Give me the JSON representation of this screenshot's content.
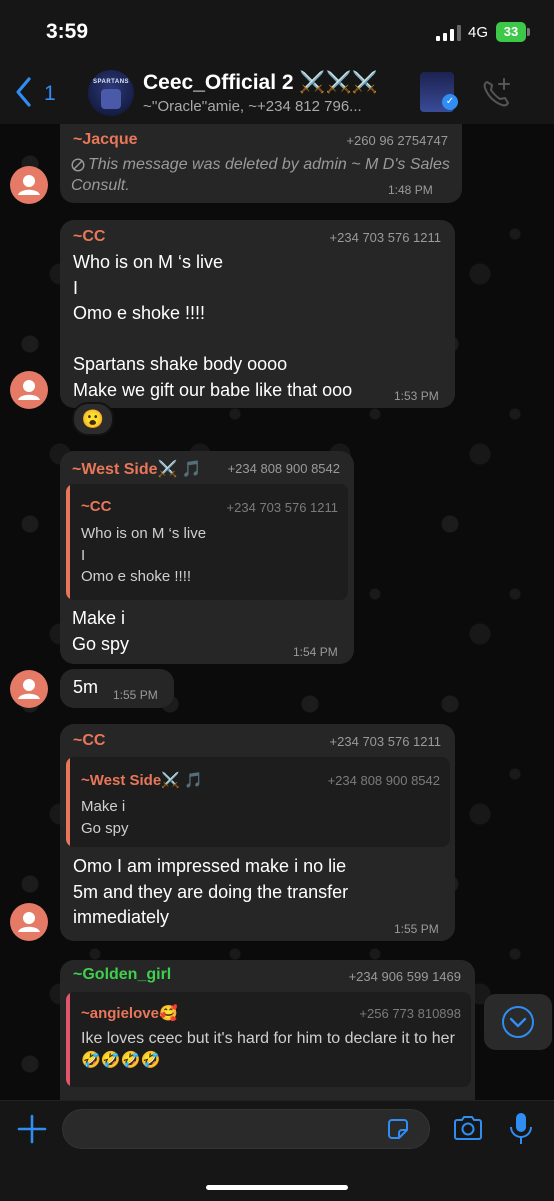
{
  "status_bar": {
    "time": "3:59",
    "network": "4G",
    "battery": "33"
  },
  "header": {
    "back_count": "1",
    "group_avatar_text": "SPARTANS",
    "title": "Ceec_Official 2 ⚔️⚔️⚔️",
    "subtitle": "~''Oracle''amie, ~+234 812 796..."
  },
  "messages": [
    {
      "sender": "~Jacque",
      "sender_color": "#e8775a",
      "phone": "+260 96 2754747",
      "deleted_text": "This message was deleted by admin ~ M D's Sales Consult.",
      "time": "1:48 PM"
    },
    {
      "sender": "~CC",
      "sender_color": "#e8775a",
      "phone": "+234 703 576 1211",
      "body": "Who is on M ‘s live\nI\nOmo e shoke !!!!\n\nSpartans shake body oooo\nMake we gift our babe like that ooo",
      "time": "1:53 PM",
      "reaction": "😮"
    },
    {
      "sender": "~West Side⚔️ 🎵",
      "sender_color": "#e8775a",
      "phone": "+234 808 900 8542",
      "quote": {
        "sender": "~CC",
        "phone": "+234 703 576 1211",
        "body": "Who is on M ‘s live\nI\nOmo e shoke !!!!"
      },
      "body": "Make i\nGo spy",
      "time": "1:54 PM"
    },
    {
      "body": "5m",
      "time": "1:55 PM"
    },
    {
      "sender": "~CC",
      "sender_color": "#e8775a",
      "phone": "+234 703 576 1211",
      "quote": {
        "sender": "~West Side⚔️ 🎵",
        "phone": "+234 808 900 8542",
        "body": "Make i\nGo spy"
      },
      "body": "Omo I am impressed make i no lie\n5m and they are doing the transfer\nimmediately",
      "time": "1:55 PM"
    },
    {
      "sender": "~Golden_girl",
      "sender_color": "#3ecf4e",
      "phone": "+234 906 599 1469",
      "quote": {
        "sender": "~angielove🥰",
        "phone": "+256 773 810898",
        "body": "Ike loves ceec but it's hard for him to declare it to her🤣🤣🤣🤣"
      }
    }
  ],
  "colors": {
    "accent": "#2f8df4",
    "bubble": "#262626",
    "quote_bar": "#e8775a",
    "quote_bar_pink": "#e0566a"
  },
  "icons": [
    "back-chevron-icon",
    "add-call-icon",
    "plus-icon",
    "sticker-icon",
    "camera-icon",
    "mic-icon",
    "scroll-down-icon",
    "blocked-icon",
    "person-icon"
  ]
}
